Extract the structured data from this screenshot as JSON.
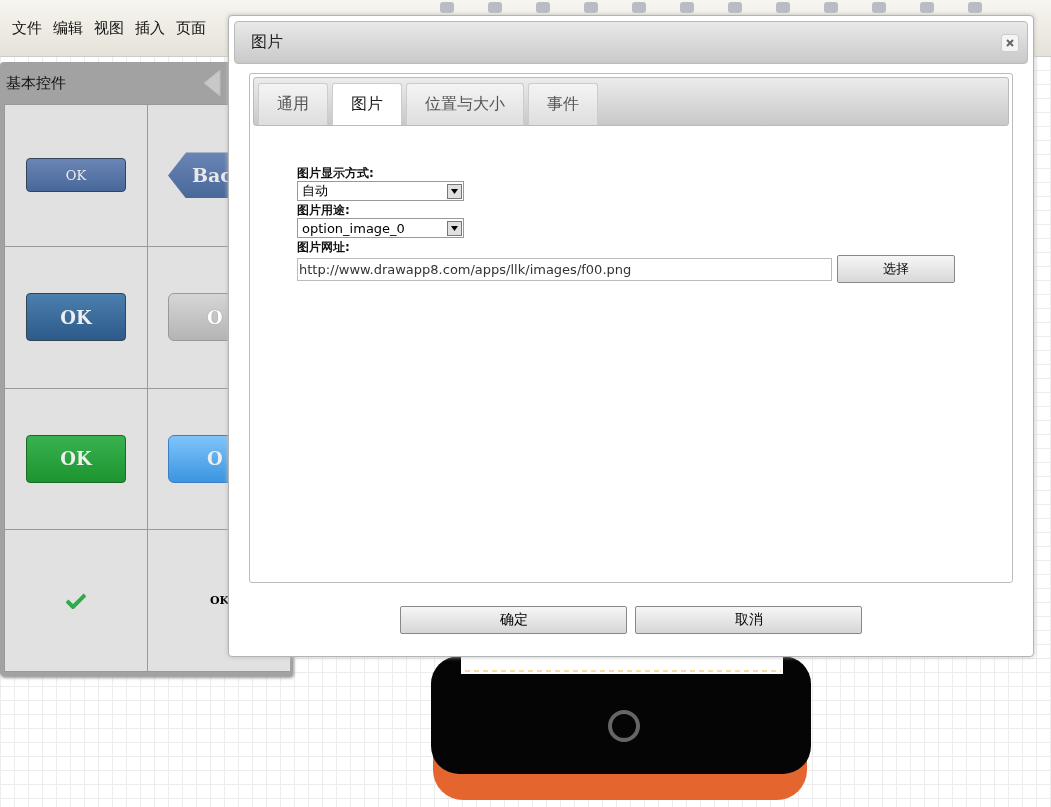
{
  "menu": [
    "文件",
    "编辑",
    "视图",
    "插入",
    "页面"
  ],
  "palette": {
    "title": "基本控件",
    "items": [
      {
        "kind": "button",
        "label": "OK"
      },
      {
        "kind": "back",
        "label": "Bac"
      },
      {
        "kind": "button",
        "label": "OK"
      },
      {
        "kind": "button",
        "label": "O"
      },
      {
        "kind": "button",
        "label": "OK"
      },
      {
        "kind": "button",
        "label": "O"
      },
      {
        "kind": "check"
      },
      {
        "kind": "text",
        "label": "OK"
      }
    ]
  },
  "dialog": {
    "title": "图片",
    "tabs": [
      {
        "label": "通用",
        "selected": false
      },
      {
        "label": "图片",
        "selected": true
      },
      {
        "label": "位置与大小",
        "selected": false
      },
      {
        "label": "事件",
        "selected": false
      }
    ],
    "fields": [
      {
        "kind": "select",
        "label": "图片显示方式:",
        "value": "自动"
      },
      {
        "kind": "select",
        "label": "图片用途:",
        "value": "option_image_0"
      },
      {
        "kind": "url",
        "label": "图片网址:",
        "value": "http://www.drawapp8.com/apps/llk/images/f00.png",
        "button": "选择"
      }
    ],
    "buttons": [
      "确定",
      "取消"
    ]
  }
}
